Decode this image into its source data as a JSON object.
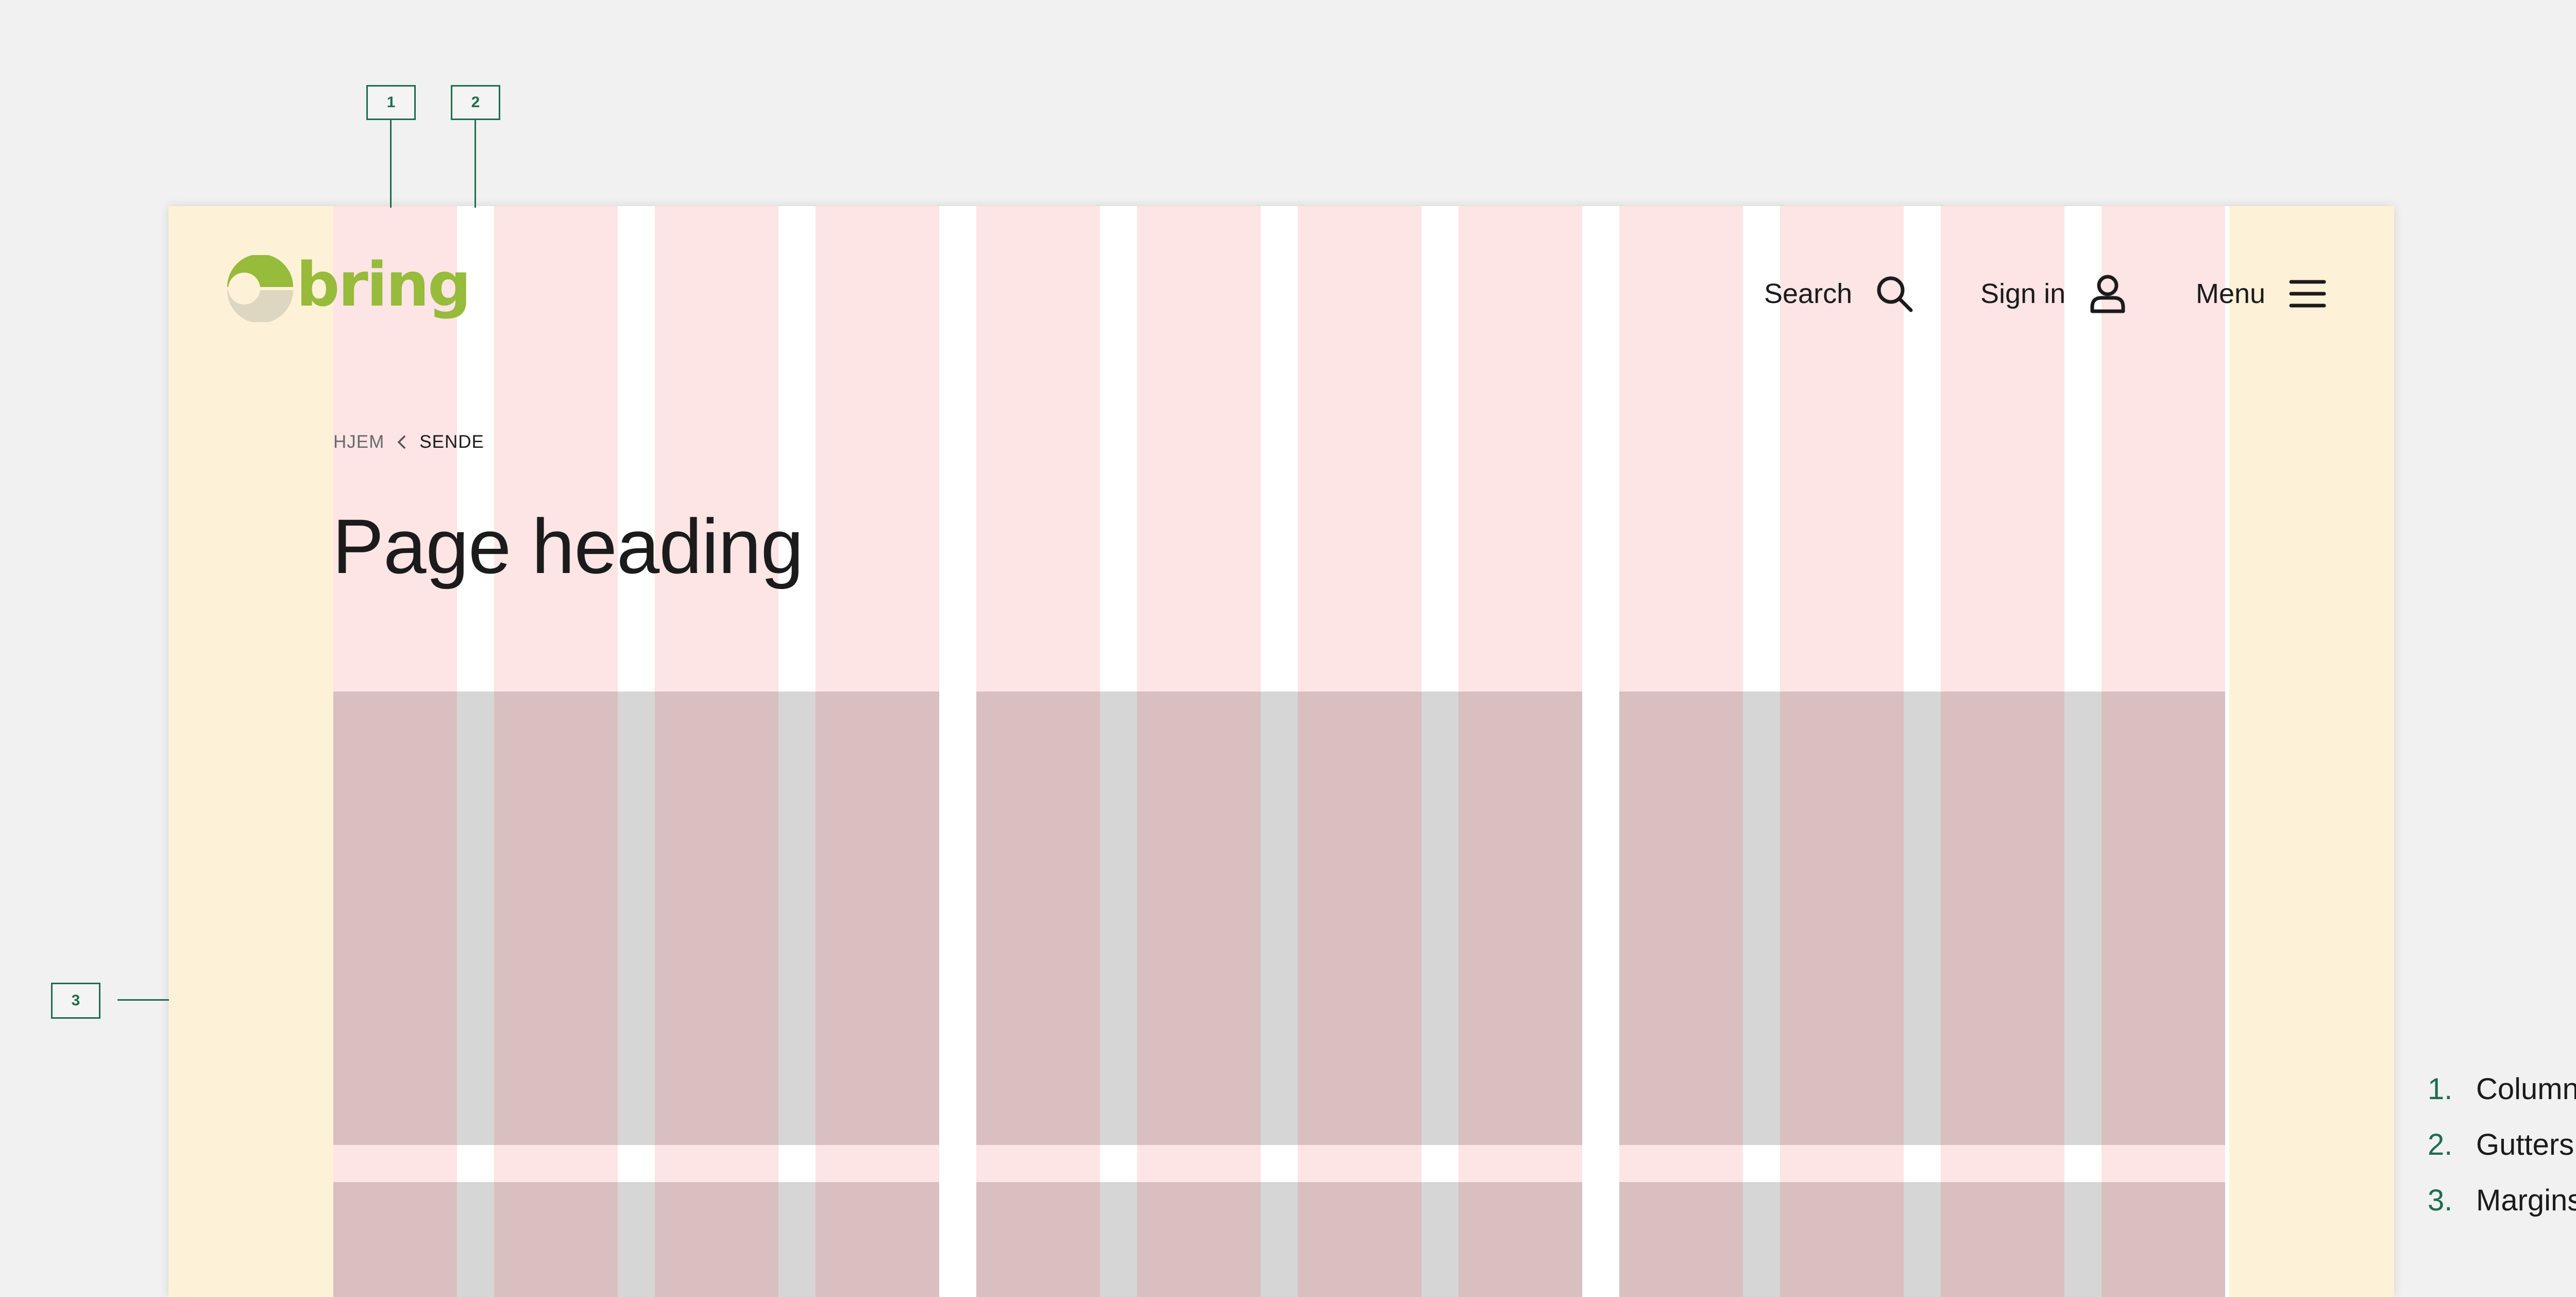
{
  "header": {
    "logo_text": "bring",
    "nav": {
      "search_label": "Search",
      "search_icon": "search-icon",
      "signin_label": "Sign in",
      "signin_icon": "user-icon",
      "menu_label": "Menu",
      "menu_icon": "hamburger-menu-icon"
    }
  },
  "breadcrumb": {
    "home": "HJEM",
    "separator_icon": "chevron-left-icon",
    "current": "SENDE"
  },
  "page": {
    "heading": "Page heading"
  },
  "annotations": {
    "markers": [
      "1",
      "2",
      "3"
    ],
    "legend": [
      {
        "num": "1.",
        "label": "Columns"
      },
      {
        "num": "2.",
        "label": "Gutters"
      },
      {
        "num": "3.",
        "label": "Margins"
      }
    ]
  },
  "grid": {
    "columns": 12,
    "content_cards_per_row": 3
  },
  "colors": {
    "background": "#f1f1f1",
    "margin": "#fdf1d8",
    "column": "#fde4e5",
    "card": "#d9bfc0",
    "card_gutter": "#d6d6d6",
    "annotation": "#1d6d4f",
    "logo_green": "#97bb3a",
    "logo_beige": "#ddd6c1"
  }
}
